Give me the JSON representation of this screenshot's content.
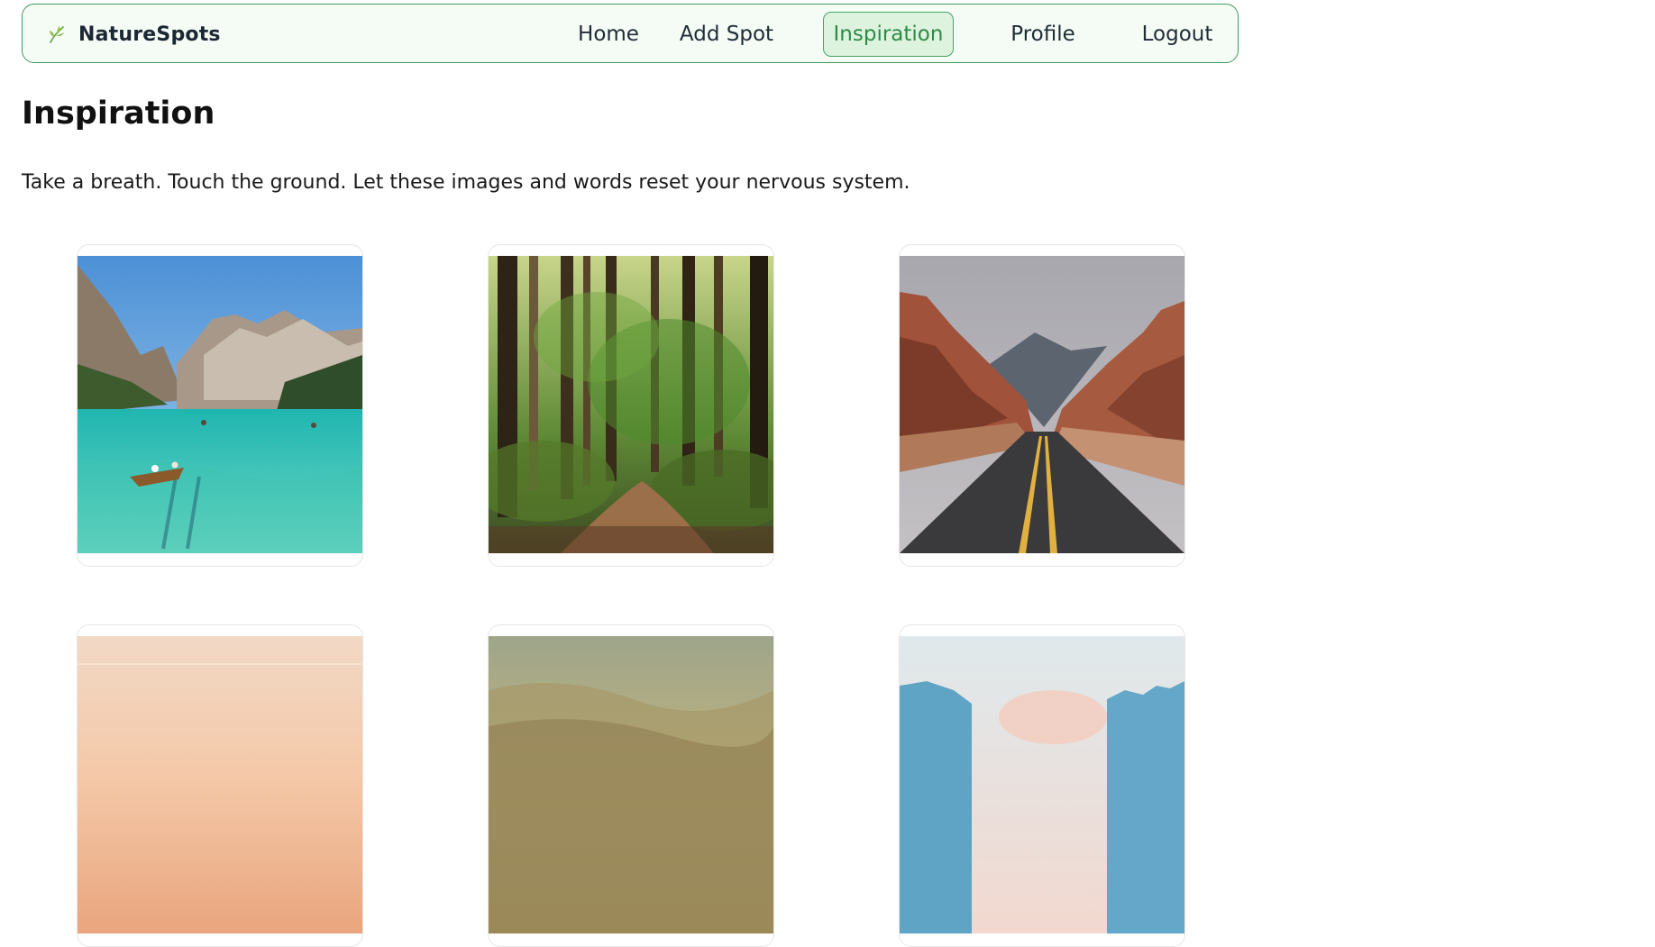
{
  "brand": {
    "name": "NatureSpots",
    "icon": "leaf-icon",
    "accent_color": "#3f9a5c"
  },
  "nav": {
    "items": [
      {
        "label": "Home"
      },
      {
        "label": "Add Spot"
      },
      {
        "label": "Inspiration",
        "active": true
      },
      {
        "label": "Profile"
      },
      {
        "label": "Logout"
      }
    ]
  },
  "page": {
    "title": "Inspiration",
    "intro": "Take a breath. Touch the ground. Let these images and words reset your nervous system."
  },
  "cards": [
    {
      "subject": "mountain-lake-rowboat-photo"
    },
    {
      "subject": "forest-path-photo"
    },
    {
      "subject": "desert-canyon-road-photo"
    },
    {
      "subject": "peach-sky-photo"
    },
    {
      "subject": "misty-hills-photo"
    },
    {
      "subject": "icy-cliffs-sunrise-photo"
    }
  ]
}
